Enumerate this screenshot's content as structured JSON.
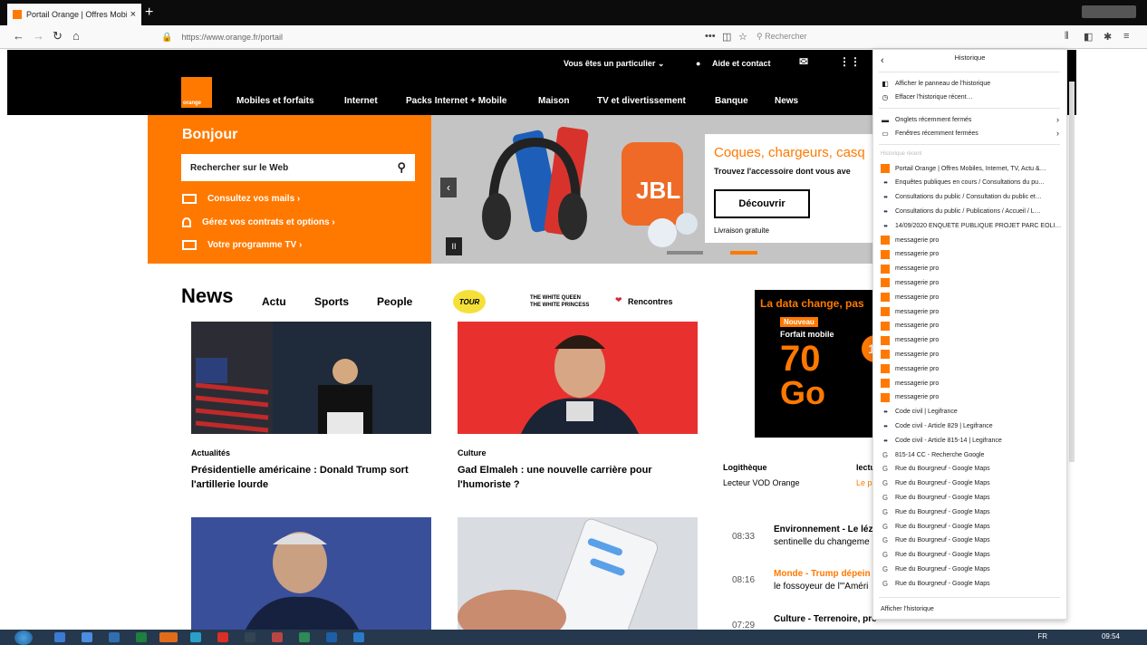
{
  "browser": {
    "tab_title": "Portail Orange | Offres Mobile",
    "tab_close": "×",
    "new_tab": "+",
    "url": "https://www.orange.fr/portail",
    "search_placeholder": "Rechercher",
    "page_actions": "•••"
  },
  "header": {
    "logo_text": "orange",
    "particulier": "Vous êtes un particulier ⌄",
    "help": "Aide et contact",
    "nav": [
      "Mobiles et forfaits",
      "Internet",
      "Packs Internet + Mobile",
      "Maison",
      "TV et divertissement",
      "Banque",
      "News"
    ]
  },
  "hero": {
    "greeting": "Bonjour",
    "search_placeholder": "Rechercher sur le Web",
    "links": [
      "Consultez vos mails ›",
      "Gérez vos contrats et options ›",
      "Votre programme TV ›"
    ],
    "promo_title": "Coques, chargeurs, casq",
    "promo_sub": "Trouvez l'accessoire dont vous ave",
    "promo_button": "Découvrir",
    "promo_note": "Livraison gratuite",
    "prev": "‹",
    "pause": "II"
  },
  "news": {
    "heading": "News",
    "tabs": [
      "Actu",
      "Sports",
      "People",
      "THE WHITE QUEEN THE WHITE PRINCESS",
      "Rencontres"
    ],
    "tour_logo": "TOUR",
    "cards": [
      {
        "category": "Actualités",
        "title": "Présidentielle américaine : Donald Trump sort l'artillerie lourde"
      },
      {
        "category": "Culture",
        "title": "Gad Elmaleh : une nouvelle carrière pour l'humoriste ?"
      }
    ]
  },
  "ad": {
    "headline": "La data change, pas",
    "badge": "Nouveau",
    "line1": "Forfait mobile",
    "big": "70",
    "unit": "Go",
    "side": "19"
  },
  "sidebar": {
    "logitheque_label": "Logithèque",
    "logitheque_item": "Lecteur VOD Orange",
    "lecture_label": "lectu",
    "lecture_item": "Le p",
    "feed": [
      {
        "time": "08:33",
        "text_bold": "Environnement - Le léz",
        "text": "sentinelle du changeme"
      },
      {
        "time": "08:16",
        "text_bold": "Monde - Trump dépein",
        "text": "le fossoyeur de l'\"Améri"
      },
      {
        "time": "07:29",
        "text_bold": "Culture - Terrenoire, pré",
        "text": ""
      }
    ]
  },
  "history": {
    "title": "Historique",
    "back": "‹",
    "show_panel": "Afficher le panneau de l'historique",
    "clear_recent": "Effacer l'historique récent…",
    "recent_tabs": "Onglets récemment fermés",
    "recent_windows": "Fenêtres récemment fermées",
    "section_label": "Historique récent",
    "entries": [
      {
        "icon": "orange",
        "label": "Portail Orange | Offres Mobiles, Internet, TV, Actu &…"
      },
      {
        "icon": "dots",
        "label": "Enquêtes publiques en cours / Consultations du pu…"
      },
      {
        "icon": "dots",
        "label": "Consultations du public / Consultation du public et…"
      },
      {
        "icon": "dots",
        "label": "Consultations du public / Publications / Accueil / L…"
      },
      {
        "icon": "dots",
        "label": "14/09/2020 ENQUETE PUBLIQUE PROJET PARC EOLI…"
      },
      {
        "icon": "orange",
        "label": "messagerie pro"
      },
      {
        "icon": "orange",
        "label": "messagerie pro"
      },
      {
        "icon": "orange",
        "label": "messagerie pro"
      },
      {
        "icon": "orange",
        "label": "messagerie pro"
      },
      {
        "icon": "orange",
        "label": "messagerie pro"
      },
      {
        "icon": "orange",
        "label": "messagerie pro"
      },
      {
        "icon": "orange",
        "label": "messagerie pro"
      },
      {
        "icon": "orange",
        "label": "messagerie pro"
      },
      {
        "icon": "orange",
        "label": "messagerie pro"
      },
      {
        "icon": "orange",
        "label": "messagerie pro"
      },
      {
        "icon": "orange",
        "label": "messagerie pro"
      },
      {
        "icon": "orange",
        "label": "messagerie pro"
      },
      {
        "icon": "dots",
        "label": "Code civil | Legifrance"
      },
      {
        "icon": "dots",
        "label": "Code civil - Article 829 | Legifrance"
      },
      {
        "icon": "dots",
        "label": "Code civil - Article 815-14 | Legifrance"
      },
      {
        "icon": "google",
        "label": "815-14 CC - Recherche Google"
      },
      {
        "icon": "google",
        "label": "Rue du Bourgneuf - Google Maps"
      },
      {
        "icon": "google",
        "label": "Rue du Bourgneuf - Google Maps"
      },
      {
        "icon": "google",
        "label": "Rue du Bourgneuf - Google Maps"
      },
      {
        "icon": "google",
        "label": "Rue du Bourgneuf - Google Maps"
      },
      {
        "icon": "google",
        "label": "Rue du Bourgneuf - Google Maps"
      },
      {
        "icon": "google",
        "label": "Rue du Bourgneuf - Google Maps"
      },
      {
        "icon": "google",
        "label": "Rue du Bourgneuf - Google Maps"
      },
      {
        "icon": "google",
        "label": "Rue du Bourgneuf - Google Maps"
      },
      {
        "icon": "google",
        "label": "Rue du Bourgneuf - Google Maps"
      }
    ],
    "show_all": "Afficher l'historique"
  },
  "taskbar": {
    "lang": "FR",
    "clock": "09:54"
  }
}
